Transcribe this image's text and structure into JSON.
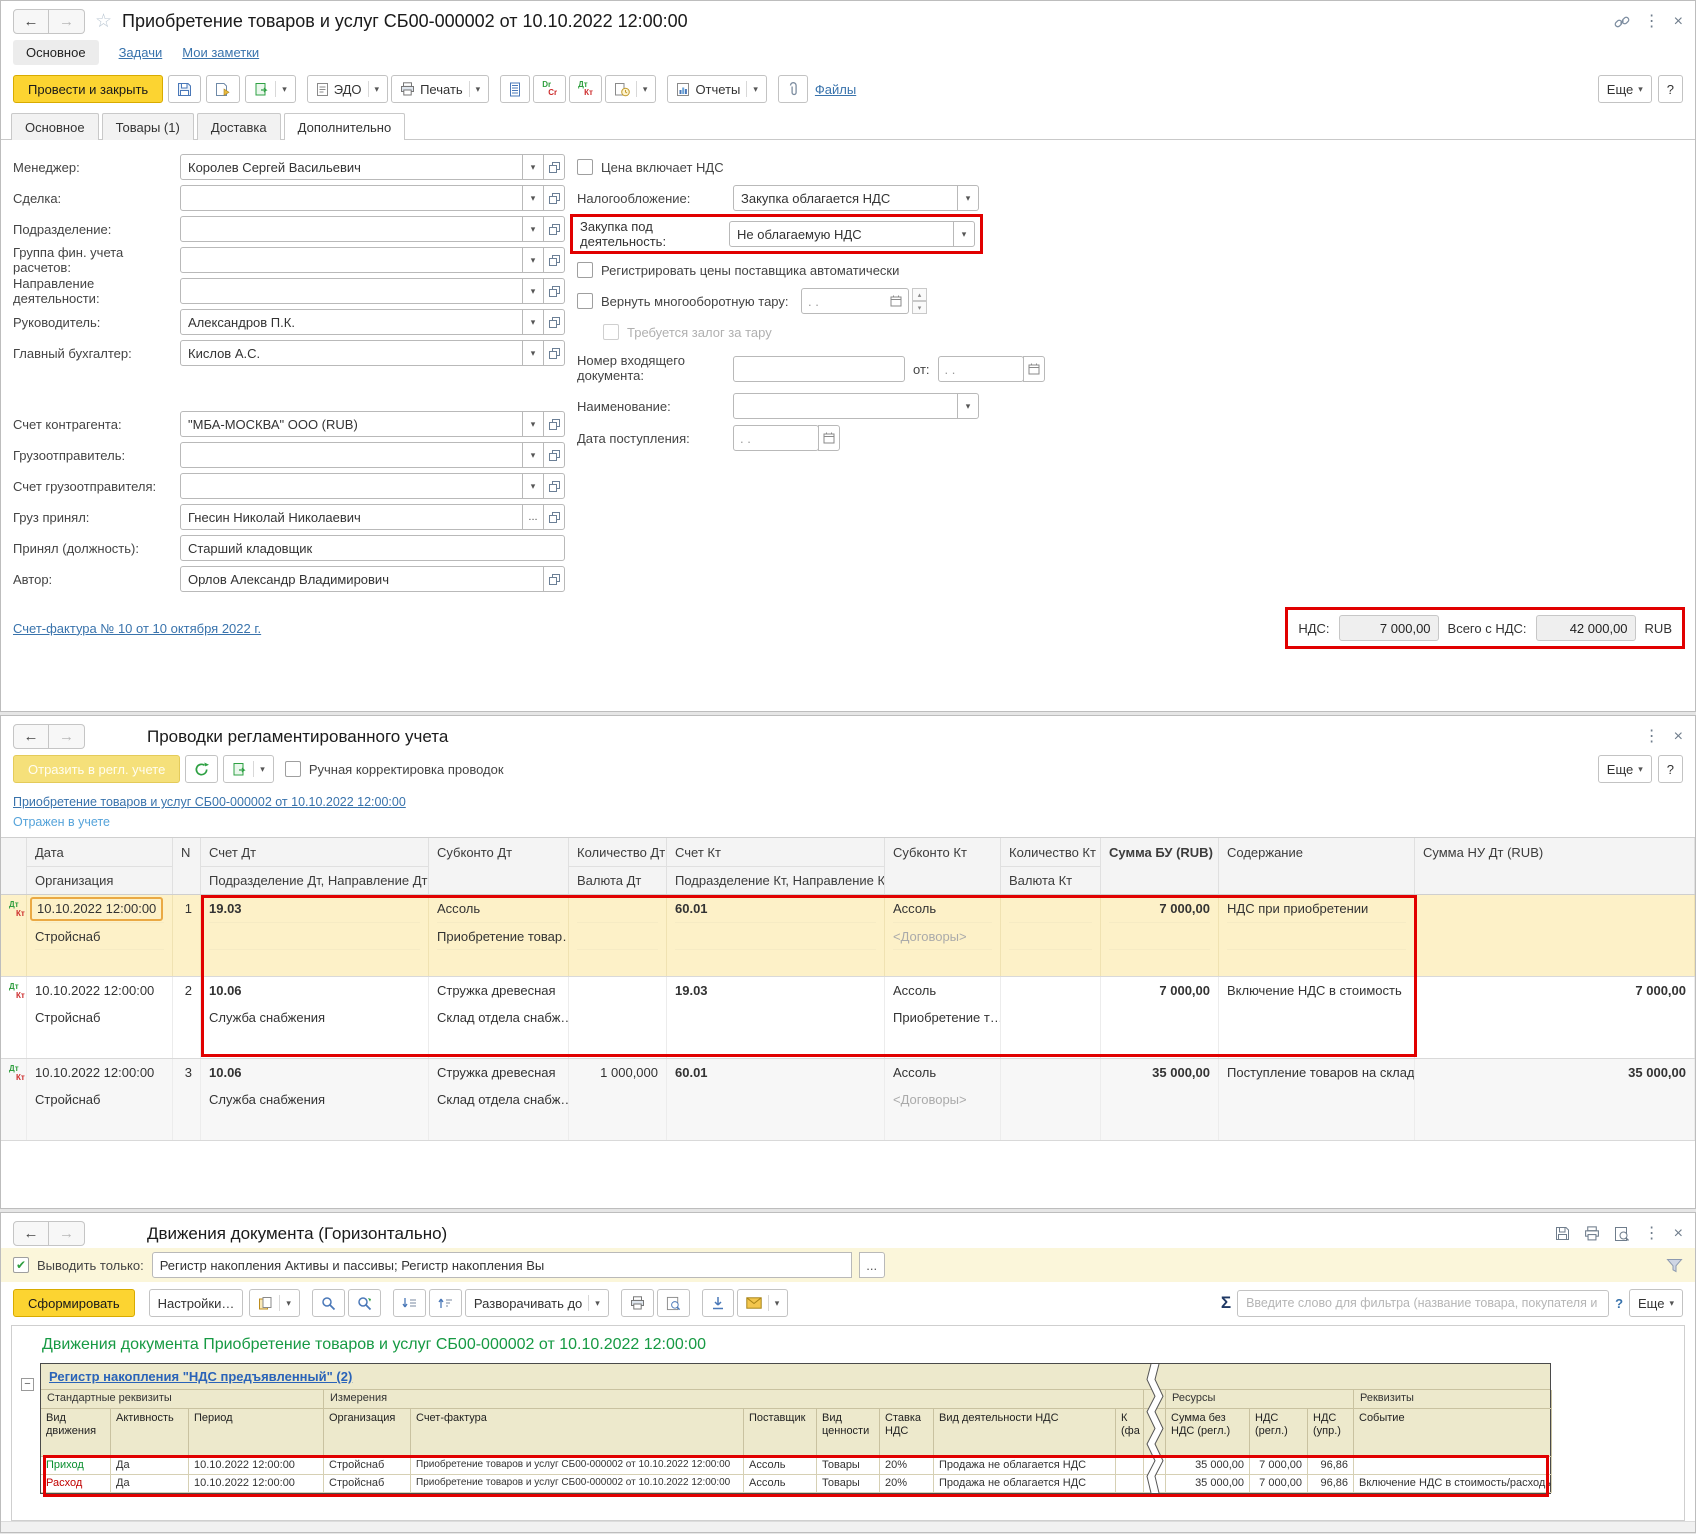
{
  "colors": {
    "accent_yellow": "#fcd431",
    "annotation_red": "#e10000",
    "report_green": "#169a43",
    "link_blue": "#3973ac",
    "status_blue": "#55a3da",
    "income_green": "#0a8f2f",
    "expense_red": "#c00000"
  },
  "doc": {
    "title": "Приобретение товаров и услуг СБ00-000002 от 10.10.2022 12:00:00",
    "nav": {
      "main": "Основное",
      "tasks": "Задачи",
      "notes": "Мои заметки"
    },
    "toolbar": {
      "post_close": "Провести и закрыть",
      "edo": "ЭДО",
      "print": "Печать",
      "reports": "Отчеты",
      "files": "Файлы",
      "more": "Еще",
      "help": "?",
      "dr": "Dr",
      "cr": "Cr",
      "dt": "Дт",
      "kt": "Кт"
    },
    "tabs": {
      "main": "Основное",
      "goods": "Товары (1)",
      "delivery": "Доставка",
      "additional": "Дополнительно"
    },
    "fields": {
      "manager": {
        "label": "Менеджер:",
        "value": "Королев Сергей Васильевич"
      },
      "deal": {
        "label": "Сделка:",
        "value": ""
      },
      "department": {
        "label": "Подразделение:",
        "value": ""
      },
      "fin_group": {
        "label": "Группа фин. учета расчетов:",
        "value": ""
      },
      "activity": {
        "label": "Направление деятельности:",
        "value": ""
      },
      "head": {
        "label": "Руководитель:",
        "value": "Александров П.К."
      },
      "accountant": {
        "label": "Главный бухгалтер:",
        "value": "Кислов А.С."
      },
      "counterparty_account": {
        "label": "Счет контрагента:",
        "value": "\"МБА-МОСКВА\" ООО (RUB)"
      },
      "consignor": {
        "label": "Грузоотправитель:",
        "value": ""
      },
      "consignor_account": {
        "label": "Счет грузоотправителя:",
        "value": ""
      },
      "cargo_accepted": {
        "label": "Груз принял:",
        "value": "Гнесин Николай Николаевич",
        "dots": "..."
      },
      "position": {
        "label": "Принял (должность):",
        "value": "Старший кладовщик"
      },
      "author": {
        "label": "Автор:",
        "value": "Орлов Александр Владимирович"
      }
    },
    "right": {
      "price_includes_vat": "Цена включает НДС",
      "taxation": {
        "label": "Налогообложение:",
        "value": "Закупка облагается НДС"
      },
      "purchase_activity": {
        "label": "Закупка под деятельность:",
        "value": "Не облагаемую НДС"
      },
      "register_prices": "Регистрировать цены поставщика автоматически",
      "return_tare": "Вернуть многооборотную тару:",
      "tare_deposit": "Требуется залог за тару",
      "incoming_number_label": "Номер входящего документа:",
      "from_label": "от:",
      "name_label": "Наименование:",
      "receipt_date_label": "Дата поступления:",
      "empty_date": ". ."
    },
    "footer": {
      "invoice_link": "Счет-фактура № 10 от 10 октября 2022 г.",
      "vat_label": "НДС:",
      "vat_value": "7 000,00",
      "total_label": "Всего с НДС:",
      "total_value": "42 000,00",
      "currency": "RUB"
    }
  },
  "postings": {
    "title": "Проводки регламентированного учета",
    "reflect_btn": "Отразить в регл. учете",
    "manual_adjust": "Ручная корректировка проводок",
    "doc_link": "Приобретение товаров и услуг СБ00-000002 от 10.10.2022 12:00:00",
    "status": "Отражен в учете",
    "more": "Еще",
    "help": "?",
    "dt": "Дт",
    "kt": "Кт",
    "head": {
      "date": "Дата",
      "org": "Организация",
      "n": "N",
      "acc_dt": "Счет Дт",
      "dep_dt": "Подразделение Дт, Направление Дт",
      "sub_dt": "Субконто Дт",
      "qty_dt": "Количество Дт",
      "cur_dt": "Валюта Дт",
      "acc_kt": "Счет Кт",
      "dep_kt": "Подразделение Кт, Направление Кт",
      "sub_kt": "Субконто Кт",
      "qty_kt": "Количество Кт",
      "cur_kt": "Валюта Кт",
      "sum_bu": "Сумма БУ (RUB)",
      "content": "Содержание",
      "sum_nu": "Сумма НУ Дт (RUB)"
    },
    "rows": [
      {
        "date": "10.10.2022 12:00:00",
        "org": "Стройснаб",
        "n": "1",
        "acc_dt": "19.03",
        "dep_dt": "",
        "sub_dt1": "Ассоль",
        "sub_dt2": "Приобретение товар…",
        "qty_dt": "",
        "acc_kt": "60.01",
        "sub_kt1": "Ассоль",
        "sub_kt2": "<Договоры>",
        "qty_kt": "",
        "sum_bu": "7 000,00",
        "content": "НДС при приобретении",
        "sum_nu": ""
      },
      {
        "date": "10.10.2022 12:00:00",
        "org": "Стройснаб",
        "n": "2",
        "acc_dt": "10.06",
        "dep_dt": "Служба снабжения",
        "sub_dt1": "Стружка древесная",
        "sub_dt2": "Склад отдела снабж…",
        "qty_dt": "",
        "acc_kt": "19.03",
        "sub_kt1": "Ассоль",
        "sub_kt2": "Приобретение т…",
        "qty_kt": "",
        "sum_bu": "7 000,00",
        "content": "Включение НДС в стоимость",
        "sum_nu": "7 000,00"
      },
      {
        "date": "10.10.2022 12:00:00",
        "org": "Стройснаб",
        "n": "3",
        "acc_dt": "10.06",
        "dep_dt": "Служба снабжения",
        "sub_dt1": "Стружка древесная",
        "sub_dt2": "Склад отдела снабж…",
        "qty_dt": "1 000,000",
        "acc_kt": "60.01",
        "sub_kt1": "Ассоль",
        "sub_kt2": "<Договоры>",
        "qty_kt": "",
        "sum_bu": "35 000,00",
        "content": "Поступление товаров на склад",
        "sum_nu": "35 000,00"
      }
    ]
  },
  "movements": {
    "title": "Движения документа (Горизонтально)",
    "show_only_label": "Выводить только:",
    "show_only_value": "Регистр накопления Активы и пассивы; Регистр накопления Вы",
    "dots": "...",
    "generate": "Сформировать",
    "settings": "Настройки…",
    "expand_to": "Разворачивать до",
    "sigma": "Σ",
    "filter_placeholder": "Введите слово для фильтра (название товара, покупателя и пр.)",
    "help": "?",
    "more": "Еще",
    "report": {
      "title": "Движения документа Приобретение товаров и услуг СБ00-000002 от 10.10.2022 12:00:00",
      "register_link": "Регистр накопления \"НДС предъявленный\" (2)",
      "collapse": "−",
      "groups": {
        "std": "Стандартные реквизиты",
        "dims": "Измерения",
        "res": "Ресурсы",
        "attrs": "Реквизиты"
      },
      "cols": {
        "type": "Вид движения",
        "active": "Активность",
        "period": "Период",
        "org": "Организация",
        "invoice": "Счет-фактура",
        "supplier": "Поставщик",
        "value_type": "Вид ценности",
        "rate": "Ставка НДС",
        "vat_activity": "Вид деятельности НДС",
        "trunc": "К (фа",
        "sum": "Сумма без НДС (регл.)",
        "vat": "НДС (регл.)",
        "vat_mgmt": "НДС (упр.)",
        "event": "Событие"
      },
      "rows": [
        {
          "type": "Приход",
          "active": "Да",
          "period": "10.10.2022 12:00:00",
          "org": "Стройснаб",
          "invoice": "Приобретение товаров и услуг СБ00-000002 от 10.10.2022 12:00:00",
          "supplier": "Ассоль",
          "value_type": "Товары",
          "rate": "20%",
          "vat_activity": "Продажа не облагается НДС",
          "sum": "35 000,00",
          "vat": "7 000,00",
          "vat_mgmt": "96,86",
          "event": ""
        },
        {
          "type": "Расход",
          "active": "Да",
          "period": "10.10.2022 12:00:00",
          "org": "Стройснаб",
          "invoice": "Приобретение товаров и услуг СБ00-000002 от 10.10.2022 12:00:00",
          "supplier": "Ассоль",
          "value_type": "Товары",
          "rate": "20%",
          "vat_activity": "Продажа не облагается НДС",
          "sum": "35 000,00",
          "vat": "7 000,00",
          "vat_mgmt": "96,86",
          "event": "Включение НДС в стоимость/расходы"
        }
      ]
    }
  }
}
